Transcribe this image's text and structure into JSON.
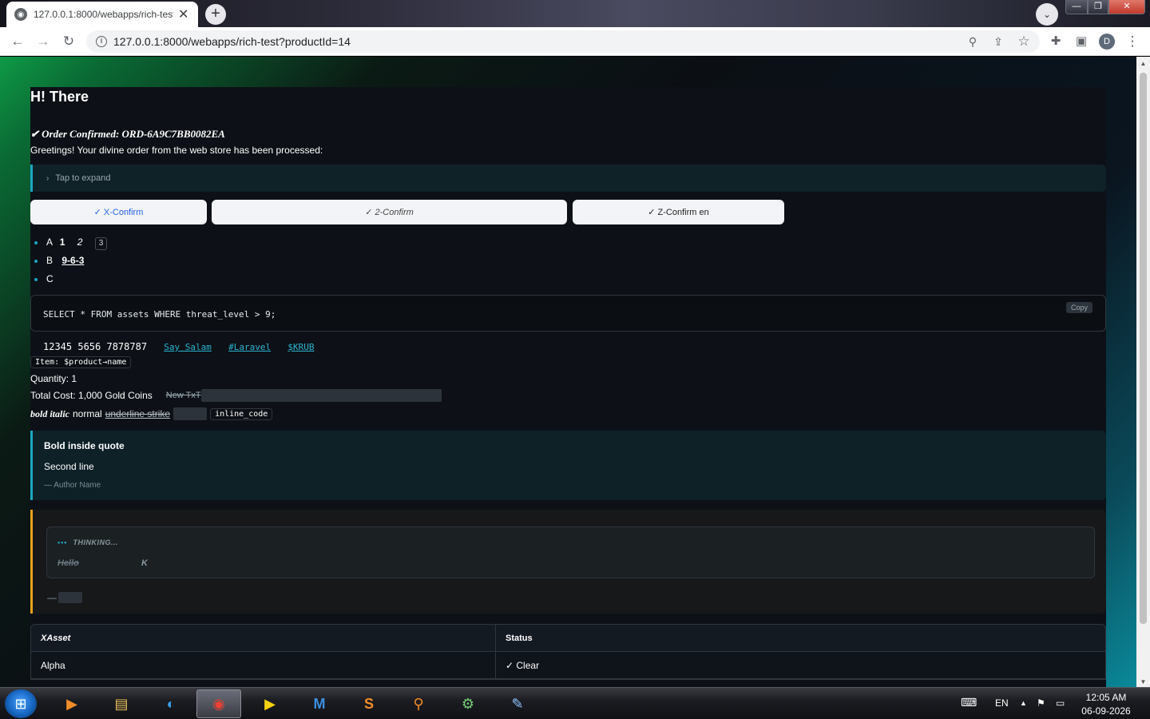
{
  "browser": {
    "tab_title": "127.0.0.1:8000/webapps/rich-test",
    "tab_close": "✕",
    "new_tab": "+",
    "url": "127.0.0.1:8000/webapps/rich-test?productId=14",
    "profile_initial": "D"
  },
  "page": {
    "heading": "H! There",
    "order_confirmed": "✔ Order Confirmed: ORD-6A9C7BB0082EA",
    "greeting": "Greetings! Your divine order from the web store has been processed:",
    "expand_label": "Tap to expand",
    "buttons": [
      "✓ X-Confirm",
      "✓ 2-Confirm",
      "✓ Z-Confirm en"
    ],
    "list": {
      "item_a_label": "A",
      "item_a_bold": "1",
      "item_a_italic": "2",
      "item_a_kbd": "3",
      "item_b_label": "B",
      "item_b_value": "9-6-3",
      "item_c_label": "C"
    },
    "code_block": "SELECT * FROM assets WHERE threat_level > 9;",
    "copy_label": "Copy",
    "inline_code": "12345 5656 7878787",
    "links": [
      "Say Salam",
      "#Laravel",
      "$KRUB"
    ],
    "item_code": "Item: $product→name",
    "quantity": "Quantity: 1",
    "total_cost": "Total Cost: 1,000 Gold Coins",
    "strike_text": "New TxT",
    "format_bold_italic": "bold italic",
    "format_normal": "normal",
    "format_underline_strike": "underline strike",
    "format_inline_code": "inline_code",
    "quote": {
      "line1": "Bold inside quote",
      "line2": "Second line",
      "author": "— Author Name"
    },
    "thinking": {
      "dots": "•••",
      "label": "THINKING...",
      "strike": "Hello",
      "k": "K",
      "dash": "—"
    },
    "table": {
      "headers": [
        "XAsset",
        "Status"
      ],
      "rows": [
        [
          "Alpha",
          "✓ Clear"
        ]
      ]
    }
  },
  "taskbar": {
    "lang": "EN",
    "time": "12:05 AM",
    "date": "06-09-2026"
  },
  "colors": {
    "accent_teal": "#1ba6c2",
    "accent_amber": "#e8a317",
    "link_blue": "#2563eb"
  }
}
